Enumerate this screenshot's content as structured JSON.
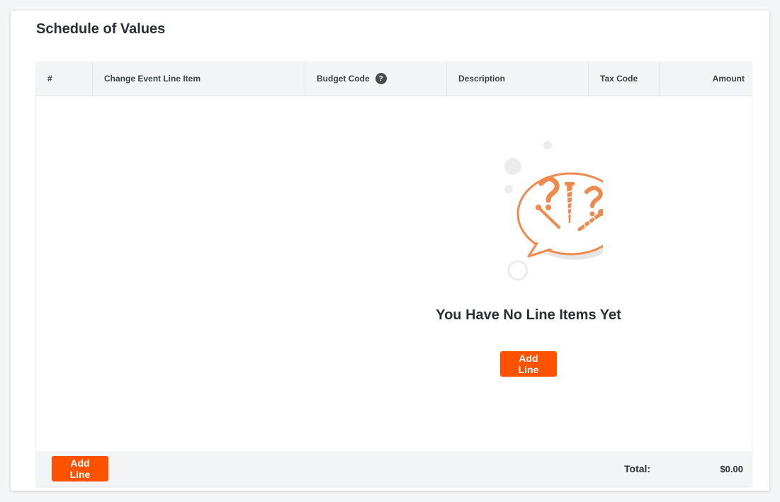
{
  "page_title": "Schedule of Values",
  "table": {
    "columns": [
      {
        "label": "#"
      },
      {
        "label": "Change Event Line Item"
      },
      {
        "label": "Budget Code",
        "help_icon": "question-icon"
      },
      {
        "label": "Description"
      },
      {
        "label": "Tax Code"
      },
      {
        "label": "Amount"
      }
    ]
  },
  "empty_state": {
    "illustration": "speech-bubble-question-screws-icon",
    "title": "You Have No Line Items Yet",
    "button_label": "Add Line"
  },
  "footer": {
    "add_line_label": "Add Line",
    "total_label": "Total:",
    "total_amount": "$0.00"
  },
  "colors": {
    "accent": "#ff5200",
    "header_bg": "#f3f4f5",
    "illustration_orange": "#f08a4b"
  }
}
